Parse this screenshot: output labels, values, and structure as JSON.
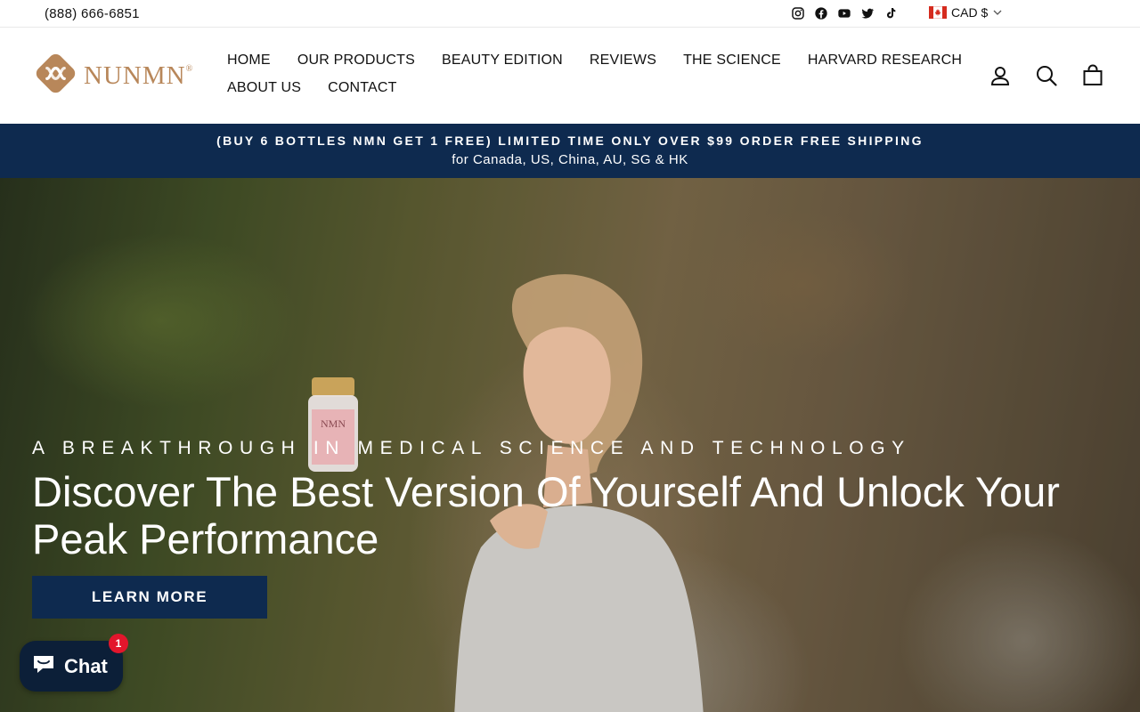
{
  "topbar": {
    "phone": "(888) 666-6851",
    "socials": [
      "instagram-icon",
      "facebook-icon",
      "youtube-icon",
      "twitter-icon",
      "tiktok-icon"
    ],
    "currency": "CAD $"
  },
  "header": {
    "logo_text": "NUNMN",
    "logo_reg": "®",
    "nav": [
      "HOME",
      "OUR PRODUCTS",
      "BEAUTY EDITION",
      "REVIEWS",
      "THE SCIENCE",
      "HARVARD RESEARCH",
      "ABOUT US",
      "CONTACT"
    ],
    "icons": [
      "account-icon",
      "search-icon",
      "cart-icon"
    ]
  },
  "announcement": {
    "line1": "(BUY 6 BOTTLES NMN GET 1 FREE) LIMITED TIME ONLY OVER $99 ORDER FREE SHIPPING",
    "line2": "for Canada, US, China, AU, SG & HK"
  },
  "hero": {
    "kicker": "A BREAKTHROUGH IN MEDICAL SCIENCE AND TECHNOLOGY",
    "headline": "Discover The Best Version Of Yourself And Unlock Your Peak Performance",
    "cta": "LEARN MORE",
    "bottle_label": "NMN"
  },
  "chat": {
    "label": "Chat",
    "badge": "1"
  },
  "colors": {
    "navy": "#0e2a4f",
    "logo_gold": "#b8875a",
    "badge_red": "#e3162c"
  }
}
